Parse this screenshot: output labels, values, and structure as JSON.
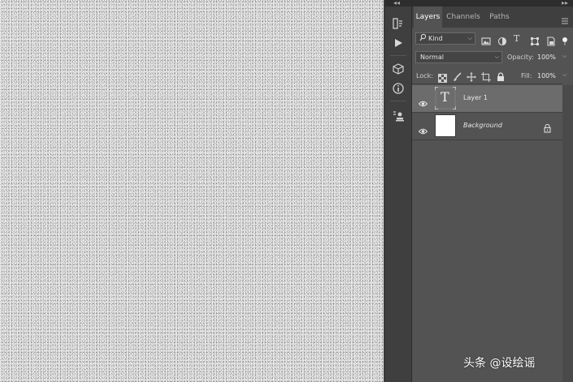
{
  "tabs": [
    {
      "label": "Layers",
      "active": true
    },
    {
      "label": "Channels",
      "active": false
    },
    {
      "label": "Paths",
      "active": false
    }
  ],
  "filter": {
    "kind_label": "Kind"
  },
  "blend": {
    "mode": "Normal",
    "opacity_label": "Opacity:",
    "opacity_value": "100%"
  },
  "lock": {
    "label": "Lock:",
    "fill_label": "Fill:",
    "fill_value": "100%"
  },
  "layers": [
    {
      "name": "Layer 1",
      "type": "text",
      "thumb_glyph": "T",
      "selected": true,
      "visible": true
    },
    {
      "name": "Background",
      "type": "raster",
      "selected": false,
      "visible": true,
      "locked": true
    }
  ],
  "watermark": "头条 @设绘谣",
  "colors": {
    "panel_bg": "#535353",
    "tab_bar": "#3f3f3f",
    "selected_layer": "#6c6c6c"
  }
}
